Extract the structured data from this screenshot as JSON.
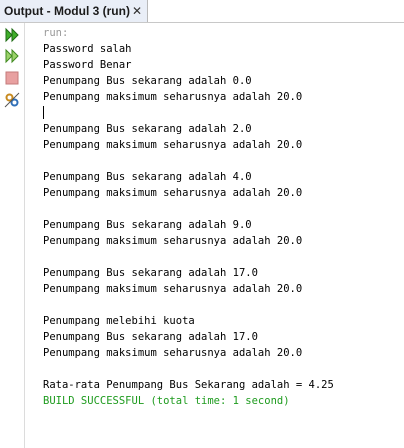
{
  "tab": {
    "title": "Output - Modul 3 (run)",
    "close_glyph": "✕"
  },
  "toolbar": {
    "icons": [
      "rerun-icon",
      "rerun-with-options-icon",
      "stop-icon",
      "settings-icon"
    ]
  },
  "console": {
    "lines": [
      {
        "text": "run:",
        "style": "gray"
      },
      {
        "text": "Password salah",
        "style": "normal"
      },
      {
        "text": "Password Benar",
        "style": "normal"
      },
      {
        "text": "Penumpang Bus sekarang adalah 0.0",
        "style": "normal"
      },
      {
        "text": "Penumpang maksimum seharusnya adalah 20.0",
        "style": "normal"
      },
      {
        "text": "Penumpang Bus sekarang adalah 2.0",
        "style": "normal"
      },
      {
        "text": "Penumpang maksimum seharusnya adalah 20.0",
        "style": "normal"
      },
      {
        "text": "Penumpang Bus sekarang adalah 4.0",
        "style": "normal"
      },
      {
        "text": "Penumpang maksimum seharusnya adalah 20.0",
        "style": "normal"
      },
      {
        "text": "Penumpang Bus sekarang adalah 9.0",
        "style": "normal"
      },
      {
        "text": "Penumpang maksimum seharusnya adalah 20.0",
        "style": "normal"
      },
      {
        "text": "Penumpang Bus sekarang adalah 17.0",
        "style": "normal"
      },
      {
        "text": "Penumpang maksimum seharusnya adalah 20.0",
        "style": "normal"
      },
      {
        "text": "Penumpang melebihi kuota",
        "style": "normal"
      },
      {
        "text": "Penumpang Bus sekarang adalah 17.0",
        "style": "normal"
      },
      {
        "text": "Penumpang maksimum seharusnya adalah 20.0",
        "style": "normal"
      },
      {
        "text": "Rata-rata Penumpang Bus Sekarang adalah = 4.25",
        "style": "normal"
      },
      {
        "text": "BUILD SUCCESSFUL (total time: 1 second)",
        "style": "green"
      }
    ]
  },
  "colors": {
    "build_success": "#1e9b1e",
    "run_label": "#9a9a9a",
    "tab_bg": "#e9eef7"
  }
}
